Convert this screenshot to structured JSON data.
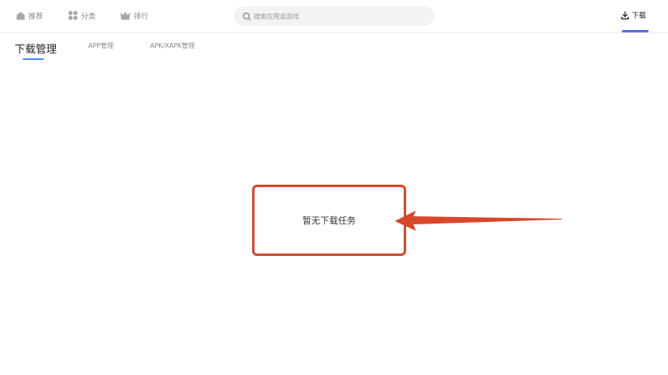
{
  "nav": {
    "items": [
      {
        "label": "推荐",
        "icon": "home-icon"
      },
      {
        "label": "分类",
        "icon": "grid-icon"
      },
      {
        "label": "排行",
        "icon": "crown-icon"
      }
    ]
  },
  "search": {
    "placeholder": "搜索应用或游戏",
    "value": ""
  },
  "download_tab": {
    "label": "下载",
    "icon": "download-icon",
    "accent": "#5b6ee8"
  },
  "subtabs": [
    {
      "label": "下载管理",
      "active": true
    },
    {
      "label": "APP管理",
      "active": false
    },
    {
      "label": "APK/XAPK管理",
      "active": false
    }
  ],
  "empty_state": {
    "message": "暂无下载任务"
  },
  "colors": {
    "annotation": "#d9472b",
    "active_underline": "#3e8ef7",
    "muted_text": "#8a8a8a"
  }
}
